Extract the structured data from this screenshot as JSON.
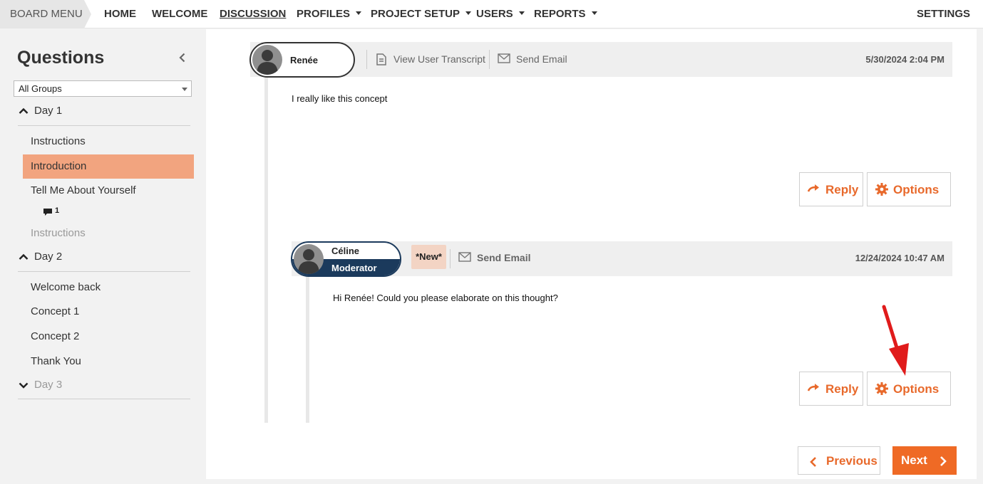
{
  "nav": {
    "board_menu": "BOARD MENU",
    "home": "HOME",
    "welcome": "WELCOME",
    "discussion": "DISCUSSION",
    "profiles": "PROFILES",
    "project_setup": "PROJECT SETUP",
    "users": "USERS",
    "reports": "REPORTS",
    "settings": "SETTINGS"
  },
  "sidebar": {
    "title": "Questions",
    "group_filter": "All Groups",
    "days": [
      {
        "label": "Day 1",
        "expanded": true,
        "items": [
          "Instructions",
          "Introduction",
          "Tell Me About Yourself",
          "Instructions"
        ],
        "selected": "Introduction",
        "comment_count": "1"
      },
      {
        "label": "Day 2",
        "expanded": true,
        "items": [
          "Welcome back",
          "Concept 1",
          "Concept 2",
          "Thank You"
        ]
      },
      {
        "label": "Day 3",
        "expanded": false
      }
    ]
  },
  "posts": [
    {
      "author": "Renée",
      "transcript_link": "View User Transcript",
      "email_link": "Send Email",
      "timestamp": "5/30/2024 2:04 PM",
      "body": "I really like this concept",
      "reply_label": "Reply",
      "options_label": "Options"
    },
    {
      "author": "Céline",
      "role": "Moderator",
      "badge": "*New*",
      "email_link": "Send Email",
      "timestamp": "12/24/2024 10:47 AM",
      "body": "Hi Renée! Could you please elaborate on this thought?",
      "reply_label": "Reply",
      "options_label": "Options"
    }
  ],
  "pager": {
    "previous": "Previous",
    "next": "Next"
  },
  "colors": {
    "accent": "#ef6a25",
    "selected_item": "#f2a47f",
    "moderator": "#1b3a5c",
    "new_badge": "#f3d4c4",
    "annotation_arrow": "#e01b1b"
  }
}
